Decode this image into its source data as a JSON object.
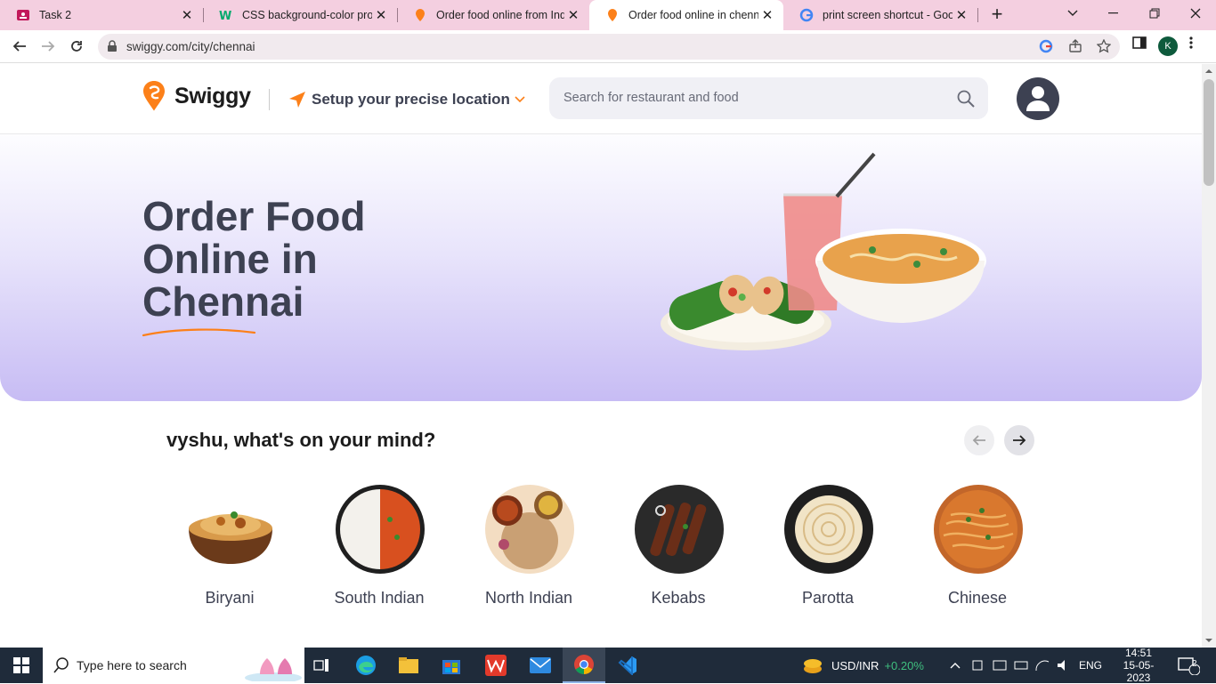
{
  "browser": {
    "tabs": [
      {
        "title": "Task 2",
        "favicon": "task-icon"
      },
      {
        "title": "CSS background-color prope",
        "favicon": "w3-icon"
      },
      {
        "title": "Order food online from India",
        "favicon": "swiggy-icon"
      },
      {
        "title": "Order food online in chennai",
        "favicon": "swiggy-icon",
        "active": true
      },
      {
        "title": "print screen shortcut - Googl",
        "favicon": "google-icon"
      }
    ],
    "url": "swiggy.com/city/chennai",
    "profile_initial": "K"
  },
  "header": {
    "brand": "Swiggy",
    "location_label": "Setup your precise location",
    "search_placeholder": "Search for restaurant and food"
  },
  "hero": {
    "title_line1": "Order Food",
    "title_line2": "Online in",
    "title_line3": "Chennai"
  },
  "mind": {
    "title": "vyshu, what's on your mind?",
    "categories": [
      {
        "label": "Biryani"
      },
      {
        "label": "South Indian"
      },
      {
        "label": "North Indian"
      },
      {
        "label": "Kebabs"
      },
      {
        "label": "Parotta"
      },
      {
        "label": "Chinese"
      }
    ]
  },
  "taskbar": {
    "search_placeholder": "Type here to search",
    "ticker": "USD/INR",
    "ticker_change": "+0.20%",
    "language": "ENG",
    "time": "14:51",
    "date": "15-05-2023",
    "notifications": "2"
  },
  "colors": {
    "brand": "#fc8019",
    "tab_strip": "#f4cfe0",
    "hero_bottom": "#c7bcf4",
    "taskbar": "#1f2b3a",
    "ticker_positive": "#3fbf7f"
  }
}
